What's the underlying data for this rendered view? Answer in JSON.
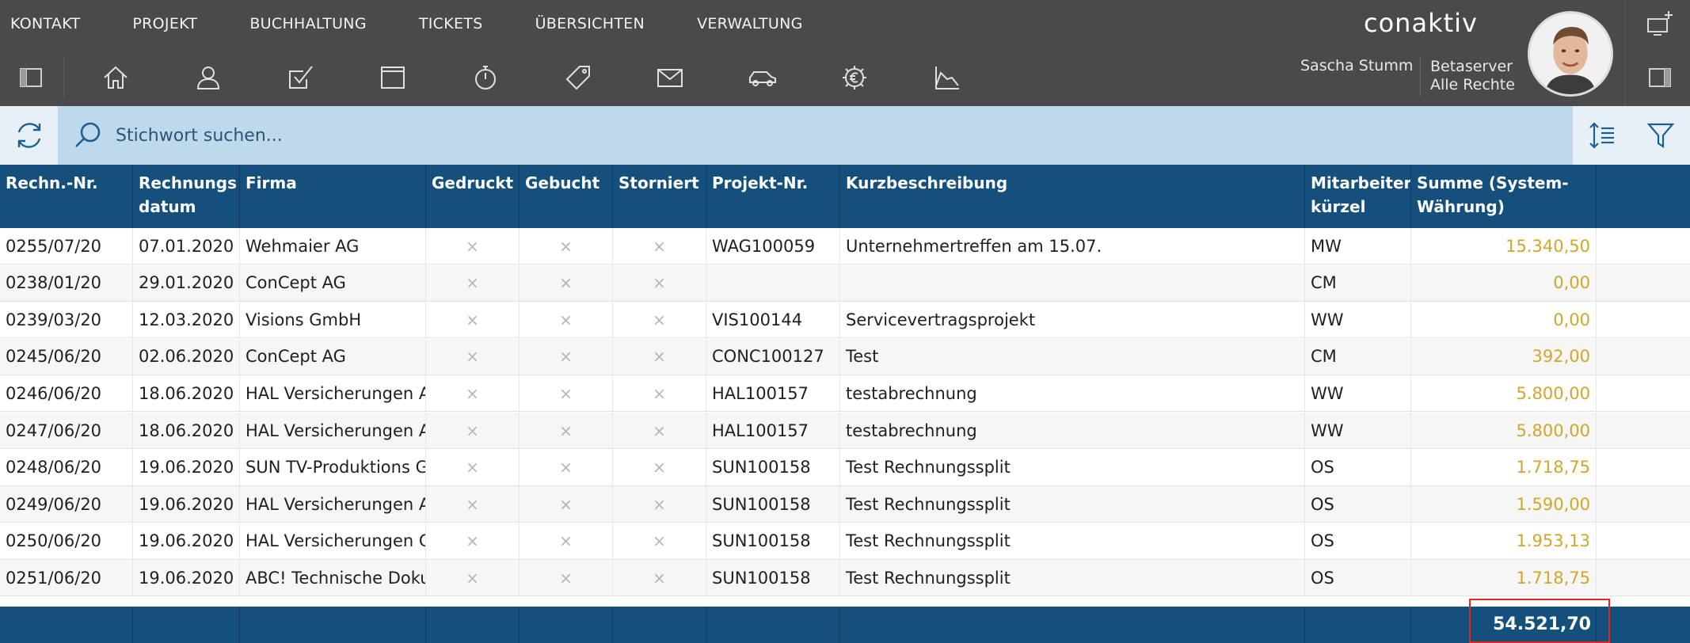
{
  "menu": [
    "KONTAKT",
    "PROJEKT",
    "BUCHHALTUNG",
    "TICKETS",
    "ÜBERSICHTEN",
    "VERWALTUNG"
  ],
  "iconbar": [
    "sidebar-toggle-icon",
    "home-icon",
    "person-icon",
    "checkbox-icon",
    "window-icon",
    "timer-icon",
    "tag-icon",
    "mail-icon",
    "car-icon",
    "euro-gear-icon",
    "chart-icon"
  ],
  "logo_text": "conaktiv",
  "user": {
    "name": "Sascha Stumm",
    "server": "Betaserver",
    "rights": "Alle Rechte"
  },
  "search": {
    "placeholder": "Stichwort suchen..."
  },
  "table": {
    "headers": [
      "Rechn.-Nr.",
      "Rechnungs datum",
      "Firma",
      "Gedruckt",
      "Gebucht",
      "Storniert",
      "Projekt-Nr.",
      "Kurzbeschreibung",
      "Mitarbeiter kürzel",
      "Summe (System-Währung)"
    ],
    "rows": [
      [
        "0255/07/20",
        "07.01.2020",
        "Wehmaier AG",
        "×",
        "×",
        "×",
        "WAG100059",
        "Unternehmertreffen am 15.07.",
        "MW",
        "15.340,50"
      ],
      [
        "0238/01/20",
        "29.01.2020",
        "ConCept AG",
        "×",
        "×",
        "×",
        "",
        "",
        "CM",
        "0,00"
      ],
      [
        "0239/03/20",
        "12.03.2020",
        "Visions GmbH",
        "×",
        "×",
        "×",
        "VIS100144",
        "Servicevertragsprojekt",
        "WW",
        "0,00"
      ],
      [
        "0245/06/20",
        "02.06.2020",
        "ConCept AG",
        "×",
        "×",
        "×",
        "CONC100127",
        "Test",
        "CM",
        "392,00"
      ],
      [
        "0246/06/20",
        "18.06.2020",
        "HAL Versicherungen AG",
        "×",
        "×",
        "×",
        "HAL100157",
        "testabrechnung",
        "WW",
        "5.800,00"
      ],
      [
        "0247/06/20",
        "18.06.2020",
        "HAL Versicherungen AG",
        "×",
        "×",
        "×",
        "HAL100157",
        "testabrechnung",
        "WW",
        "5.800,00"
      ],
      [
        "0248/06/20",
        "19.06.2020",
        "SUN TV-Produktions GmbH",
        "×",
        "×",
        "×",
        "SUN100158",
        "Test Rechnungssplit",
        "OS",
        "1.718,75"
      ],
      [
        "0249/06/20",
        "19.06.2020",
        "HAL Versicherungen AG",
        "×",
        "×",
        "×",
        "SUN100158",
        "Test Rechnungssplit",
        "OS",
        "1.590,00"
      ],
      [
        "0250/06/20",
        "19.06.2020",
        "HAL Versicherungen GmbH",
        "×",
        "×",
        "×",
        "SUN100158",
        "Test Rechnungssplit",
        "OS",
        "1.953,13"
      ],
      [
        "0251/06/20",
        "19.06.2020",
        "ABC! Technische Dokumentation",
        "×",
        "×",
        "×",
        "SUN100158",
        "Test Rechnungssplit",
        "OS",
        "1.718,75"
      ]
    ],
    "total": "54.521,70"
  },
  "colors": {
    "topbar": "#4a4a4a",
    "header": "#15507d",
    "searchbar": "#bed8ec",
    "money": "#d3a52b",
    "total_border": "#e02626"
  }
}
